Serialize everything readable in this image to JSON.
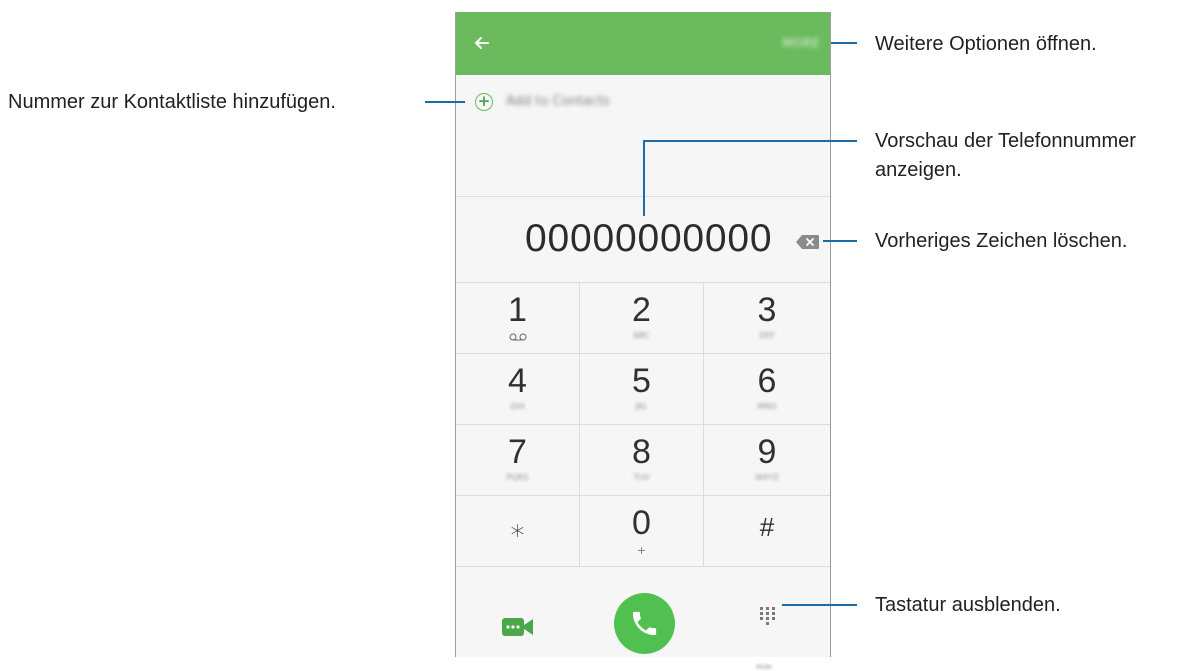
{
  "phone": {
    "appbar": {
      "back_icon": "arrow-left-icon",
      "more_label": "MORE"
    },
    "add_contact": {
      "icon": "plus-circle-icon",
      "label": "Add to Contacts"
    },
    "number": "00000000000",
    "backspace_icon": "backspace-icon",
    "keys": [
      {
        "digit": "1",
        "sub": "QO"
      },
      {
        "digit": "2",
        "sub": "ABC"
      },
      {
        "digit": "3",
        "sub": "DEF"
      },
      {
        "digit": "4",
        "sub": "GHI"
      },
      {
        "digit": "5",
        "sub": "JKL"
      },
      {
        "digit": "6",
        "sub": "MNO"
      },
      {
        "digit": "7",
        "sub": "PQRS"
      },
      {
        "digit": "8",
        "sub": "TUV"
      },
      {
        "digit": "9",
        "sub": "WXYZ"
      },
      {
        "digit": "⁎",
        "sub": ""
      },
      {
        "digit": "0",
        "sub": "+"
      },
      {
        "digit": "#",
        "sub": ""
      }
    ],
    "bottom": {
      "video_icon": "video-call-icon",
      "call_icon": "phone-icon",
      "keypad_icon": "dialpad-icon",
      "keypad_label": "Hide"
    }
  },
  "callouts": {
    "more_options": "Weitere Optionen öffnen.",
    "add_contact": "Nummer zur Kontaktliste hinzufügen.",
    "preview_line1": "Vorschau der Telefonnummer",
    "preview_line2": "anzeigen.",
    "delete_char": "Vorheriges Zeichen löschen.",
    "hide_keypad": "Tastatur ausblenden."
  },
  "colors": {
    "appbar": "#6cba5e",
    "call_button": "#50c050",
    "callout_line": "#1a6ca8"
  }
}
